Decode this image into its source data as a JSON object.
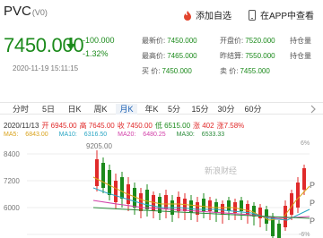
{
  "header": {
    "title": "PVC",
    "title_suffix": "(V0)",
    "add_favorite_label": "添加自选",
    "open_app_label": "在APP中查看"
  },
  "quote": {
    "price": "7450.000",
    "change": "-100.000",
    "change_pct": "-1.32%",
    "timestamp": "2020-11-19 15:11:15",
    "stats": [
      {
        "label": "最新价:",
        "value": "7450.000"
      },
      {
        "label": "开盘价:",
        "value": "7520.000"
      },
      {
        "label": "持仓量",
        "value": ""
      },
      {
        "label": "最高价:",
        "value": "7465.000"
      },
      {
        "label": "昨结算:",
        "value": "7550.000"
      },
      {
        "label": "持仓量",
        "value": ""
      },
      {
        "label": "买  价:",
        "value": "7450.000"
      },
      {
        "label": "卖  价:",
        "value": "7455.000"
      }
    ]
  },
  "tabs": [
    "分时",
    "5日",
    "日K",
    "周K",
    "月K",
    "年K",
    "5分",
    "15分",
    "30分",
    "60分"
  ],
  "active_tab": "月K",
  "kline_info": {
    "date": "2020/11/13",
    "open": "开 6945.00",
    "high": "高 7645.00",
    "close": "收 7450.00",
    "low": "低 6515.00",
    "amp": "涨 402",
    "pct_label": "涨",
    "pct": "7.58%"
  },
  "ma": [
    {
      "label": "MA5:",
      "value": "6843.00"
    },
    {
      "label": "MA10:",
      "value": "6316.50"
    },
    {
      "label": "MA20:",
      "value": "6480.25"
    },
    {
      "label": "MA30:",
      "value": "6533.33"
    }
  ],
  "chart_labels": {
    "peak": "9205.00",
    "yticks": [
      "8400",
      "7200",
      "6000"
    ],
    "pct_ticks": [
      "6%",
      "-6%"
    ],
    "watermark": "新浪财经"
  },
  "colors": {
    "up": "#e02a2a",
    "down": "#1b8a1b",
    "ma5": "#d9a21b",
    "ma10": "#2aa6c4",
    "ma20": "#d23fa8",
    "ma30": "#2a8b3a",
    "active_tab": "#1a5fb4"
  }
}
